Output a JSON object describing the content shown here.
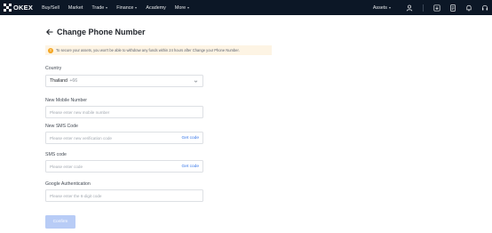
{
  "nav": {
    "brand": "OKEX",
    "items": [
      "Buy/Sell",
      "Market",
      "Trade",
      "Finance",
      "Academy",
      "More"
    ],
    "assets": "Assets"
  },
  "page": {
    "title": "Change Phone Number",
    "notice": "To secure your assets, you won't be able to withdraw any funds within 24 hours after Change your Phone Number."
  },
  "form": {
    "country_label": "Country",
    "country_value": "Thailand",
    "country_code": "+66",
    "mobile_label": "New Mobile Number",
    "mobile_placeholder": "Please enter new mobile number",
    "sms_label": "New SMS Code",
    "sms_placeholder": "Please enter new verification code",
    "old_sms_label": "SMS code",
    "old_sms_placeholder": "Please enter code",
    "get_code": "Get code",
    "google_label": "Google Authentication",
    "google_placeholder": "Please enter the 6-digit code",
    "confirm": "Confirm"
  },
  "colors": {
    "nav_bg": "#0c1726",
    "accent": "#3576e8",
    "confirm_disabled": "#b8ccf6",
    "notice_bg": "#fdf4e4",
    "warning": "#f4a622"
  }
}
